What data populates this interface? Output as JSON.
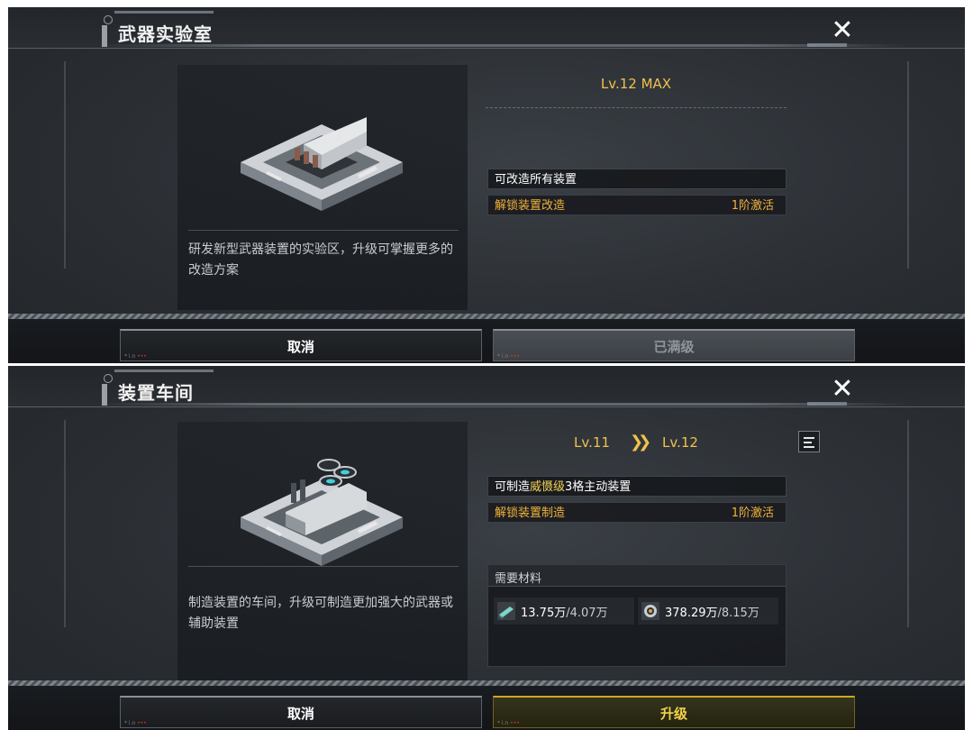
{
  "panels": [
    {
      "title": "武器实验室",
      "description": "研发新型武器装置的实验区，升级可掌握更多的改造方案",
      "level": {
        "label": "Lv.12 MAX"
      },
      "features": [
        {
          "text": "可改造所有装置"
        },
        {
          "text": "解锁装置改造",
          "value": "1阶激活"
        }
      ],
      "buttons": {
        "cancel": "取消",
        "confirm": "已满级"
      }
    },
    {
      "title": "装置车间",
      "description": "制造装置的车间，升级可制造更加强大的武器或辅助装置",
      "level": {
        "from": "Lv.11",
        "to": "Lv.12"
      },
      "features": [
        {
          "prefix": "可制造",
          "highlight": "威慑级",
          "suffix": "3格主动装置"
        },
        {
          "text": "解锁装置制造",
          "value": "1阶激活"
        }
      ],
      "materials": {
        "title": "需要材料",
        "items": [
          {
            "owned": "13.75万",
            "required": "/4.07万",
            "icon": "alloy-plate-icon"
          },
          {
            "owned": "378.29万",
            "required": "/8.15万",
            "icon": "gear-part-icon"
          }
        ]
      },
      "buttons": {
        "cancel": "取消",
        "confirm": "升级"
      }
    }
  ],
  "colors": {
    "accent": "#f0c14b",
    "gold_text": "#f0b23a",
    "highlight": "#f2d35a"
  },
  "icons": [
    "close-icon",
    "info-list-icon",
    "lab-building-icon",
    "workshop-building-icon"
  ]
}
